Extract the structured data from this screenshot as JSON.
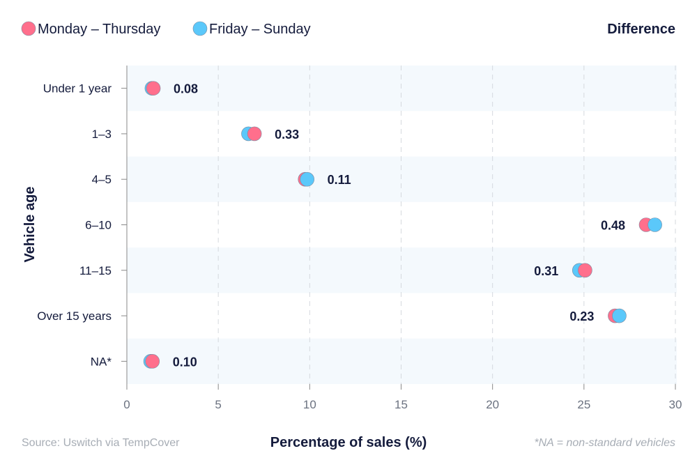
{
  "chart_data": {
    "type": "dot-plot",
    "xlabel": "Percentage of sales (%)",
    "ylabel": "Vehicle age",
    "xlim": [
      0,
      30
    ],
    "xticks": [
      0,
      5,
      10,
      15,
      20,
      25,
      30
    ],
    "grid": "vertical dashed",
    "legend_placement": "top-left",
    "difference_header": "Difference",
    "source": "Source: Uswitch via TempCover",
    "footnote": "*NA = non-standard vehicles",
    "categories": [
      "Under 1 year",
      "1–3",
      "4–5",
      "6–10",
      "11–15",
      "Over 15 years",
      "NA*"
    ],
    "series": [
      {
        "name": "Monday – Thursday",
        "color": "#ff6f8c",
        "values": [
          1.45,
          6.98,
          9.75,
          28.4,
          25.06,
          26.7,
          1.4
        ]
      },
      {
        "name": "Friday – Sunday",
        "color": "#5bc8fa",
        "values": [
          1.37,
          6.65,
          9.86,
          28.88,
          24.75,
          26.93,
          1.3
        ]
      }
    ],
    "differences": [
      "0.08",
      "0.33",
      "0.11",
      "0.48",
      "0.31",
      "0.23",
      "0.10"
    ]
  }
}
